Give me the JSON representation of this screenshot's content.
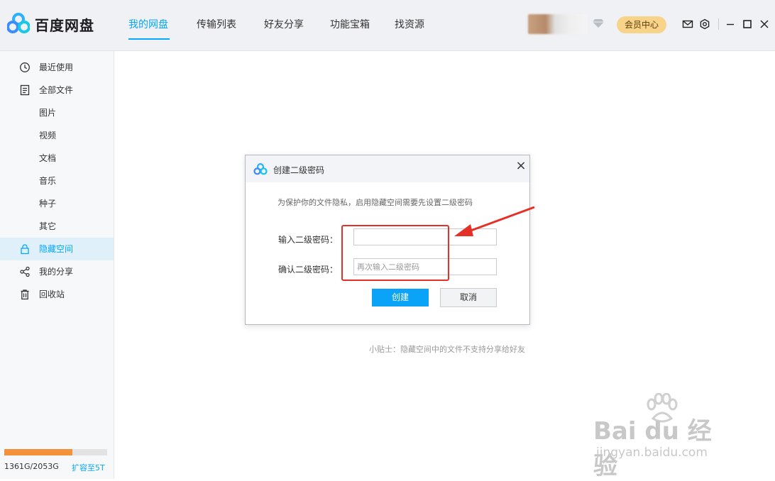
{
  "app": {
    "title": "百度网盘"
  },
  "nav": {
    "tabs": [
      {
        "label": "我的网盘",
        "active": true
      },
      {
        "label": "传输列表"
      },
      {
        "label": "好友分享"
      },
      {
        "label": "功能宝箱"
      },
      {
        "label": "找资源"
      }
    ]
  },
  "header": {
    "vip_label": "会员中心",
    "icons": [
      "mail-icon",
      "settings-icon",
      "minimize-icon",
      "maximize-icon",
      "close-icon"
    ]
  },
  "sidebar": {
    "items": [
      {
        "label": "最近使用",
        "icon": "clock-icon"
      },
      {
        "label": "全部文件",
        "icon": "file-icon"
      },
      {
        "label": "图片"
      },
      {
        "label": "视频"
      },
      {
        "label": "文档"
      },
      {
        "label": "音乐"
      },
      {
        "label": "种子"
      },
      {
        "label": "其它"
      },
      {
        "label": "隐藏空间",
        "icon": "lock-icon",
        "active": true
      },
      {
        "label": "我的分享",
        "icon": "share-icon"
      },
      {
        "label": "回收站",
        "icon": "trash-icon"
      }
    ],
    "quota": {
      "text": "1361G/2053G",
      "used_fraction": 0.663,
      "expand_label": "扩容至5T"
    }
  },
  "main": {
    "tip": "小贴士：隐藏空间中的文件不支持分享给好友"
  },
  "dialog": {
    "title": "创建二级密码",
    "description": "为保护你的文件隐私，启用隐藏空间需要先设置二级密码",
    "password_label": "输入二级密码：",
    "password_value": "",
    "confirm_label": "确认二级密码：",
    "confirm_placeholder": "再次输入二级密码",
    "create_button": "创建",
    "cancel_button": "取消",
    "close_symbol": "×"
  },
  "colors": {
    "accent": "#06a7ff",
    "vip": "#f7d48a",
    "annotation": "#e53026",
    "quota": "#f3923a"
  },
  "watermark": {
    "brand": "Bai du 经验",
    "url": "jingyan.baidu.com"
  }
}
